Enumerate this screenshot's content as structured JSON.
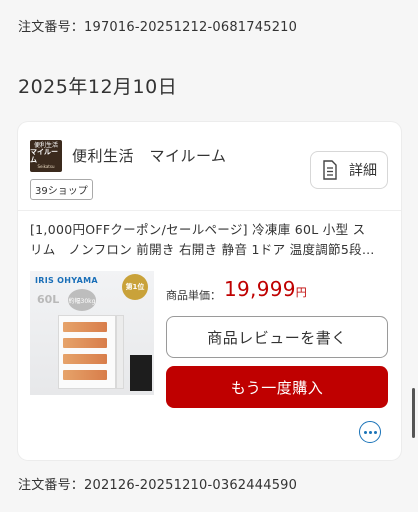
{
  "order_top": {
    "label": "注文番号：",
    "value": "197016-20251212-0681745210"
  },
  "date_heading": "2025年12月10日",
  "shop": {
    "logo_text": [
      "便利生活",
      "マイルーム",
      "Seikatsu"
    ],
    "name": "便利生活　マイルーム",
    "badge": "39ショップ"
  },
  "detail_button": {
    "label": "詳細",
    "icon": "document-list-icon"
  },
  "product": {
    "title_line1": "[1,000円OFFクーポン/セールページ] 冷凍庫 60L  小型 ス",
    "title_line2": "リム　ノンフロン 前開き 右開き 静音 1ドア 温度調節5段…",
    "image_texts": {
      "brand": "IRIS OHYAMA",
      "capacity": "60L",
      "badge": "約幅30kg",
      "rank": "第1位"
    },
    "price_label": "商品単価：",
    "price_value": "19,999",
    "price_unit": "円"
  },
  "buttons": {
    "review": "商品レビューを書く",
    "rebuy": "もう一度購入"
  },
  "more_icon": "more-horizontal-icon",
  "order_bottom": {
    "label": "注文番号：",
    "value": "202126-20251210-0362444590"
  },
  "colors": {
    "accent_red": "#bf0000",
    "link_blue": "#1a73b8"
  }
}
